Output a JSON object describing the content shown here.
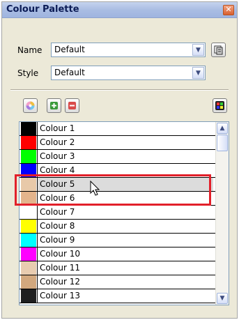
{
  "panel": {
    "title": "Colour Palette",
    "close_glyph": "✕"
  },
  "fields": {
    "name_label": "Name",
    "name_value": "Default",
    "style_label": "Style",
    "style_value": "Default",
    "dropdown_glyph": "▼"
  },
  "toolbar": {
    "icons": [
      "color-wheel-icon",
      "add-colour-icon",
      "remove-colour-icon",
      "palette-grid-icon",
      "browse-palette-icon"
    ]
  },
  "colours": {
    "selected_index": 4,
    "highlighted_range": [
      4,
      5
    ],
    "items": [
      {
        "label": "Colour 1",
        "swatch": "#000000"
      },
      {
        "label": "Colour 2",
        "swatch": "#ff0000"
      },
      {
        "label": "Colour 3",
        "swatch": "#00ff00"
      },
      {
        "label": "Colour 4",
        "swatch": "#0000ff"
      },
      {
        "label": "Colour 5",
        "swatch": "#e8c9a9"
      },
      {
        "label": "Colour 6",
        "swatch": "#e3b48c"
      },
      {
        "label": "Colour 7",
        "swatch": "#ffffff"
      },
      {
        "label": "Colour 8",
        "swatch": "#ffff00"
      },
      {
        "label": "Colour 9",
        "swatch": "#00ffff"
      },
      {
        "label": "Colour 10",
        "swatch": "#ff00ff"
      },
      {
        "label": "Colour 11",
        "swatch": "#e8ccb0"
      },
      {
        "label": "Colour 12",
        "swatch": "#d2a87e"
      },
      {
        "label": "Colour 13",
        "swatch": "#1e1e1e"
      }
    ]
  },
  "scrollbar": {
    "up_glyph": "▲",
    "down_glyph": "▼"
  },
  "colors": {
    "highlight": "#e2202a",
    "title_text": "#0c1c56"
  }
}
